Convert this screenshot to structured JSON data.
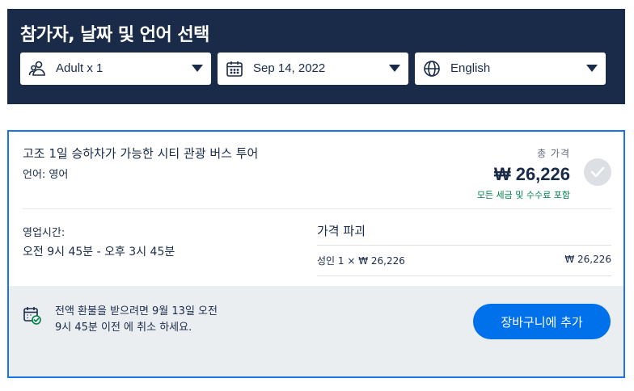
{
  "header": {
    "title": "참가자, 날짜 및 언어 선택",
    "participants": {
      "icon": "participants-icon",
      "value": "Adult x 1"
    },
    "date": {
      "icon": "calendar-icon",
      "value": "Sep 14, 2022"
    },
    "language": {
      "icon": "globe-icon",
      "value": "English"
    }
  },
  "option": {
    "title": "고조 1일 승하차가 가능한 시티 관광 버스 투어",
    "language": "언어: 영어",
    "total_label": "총 가격",
    "price": "₩ 26,226",
    "tax_note": "모든 세금 및 수수료 포함",
    "hours_label": "영업시간:",
    "hours_value": "오전 9시 45분 - 오후 3시 45분",
    "breakdown_title": "가격 파괴",
    "breakdown_label": "성인 1 × ₩ 26,226",
    "breakdown_value": "₩ 26,226",
    "refund_text": "전액 환불을 받으려면 9월 13일 오전 9시 45분 이전 에 취소 하세요.",
    "cart_button": "장바구니에 추가"
  },
  "colors": {
    "header_bg": "#1a2b49",
    "accent": "#1a73e8",
    "button": "#0071eb",
    "success": "#00804a"
  }
}
